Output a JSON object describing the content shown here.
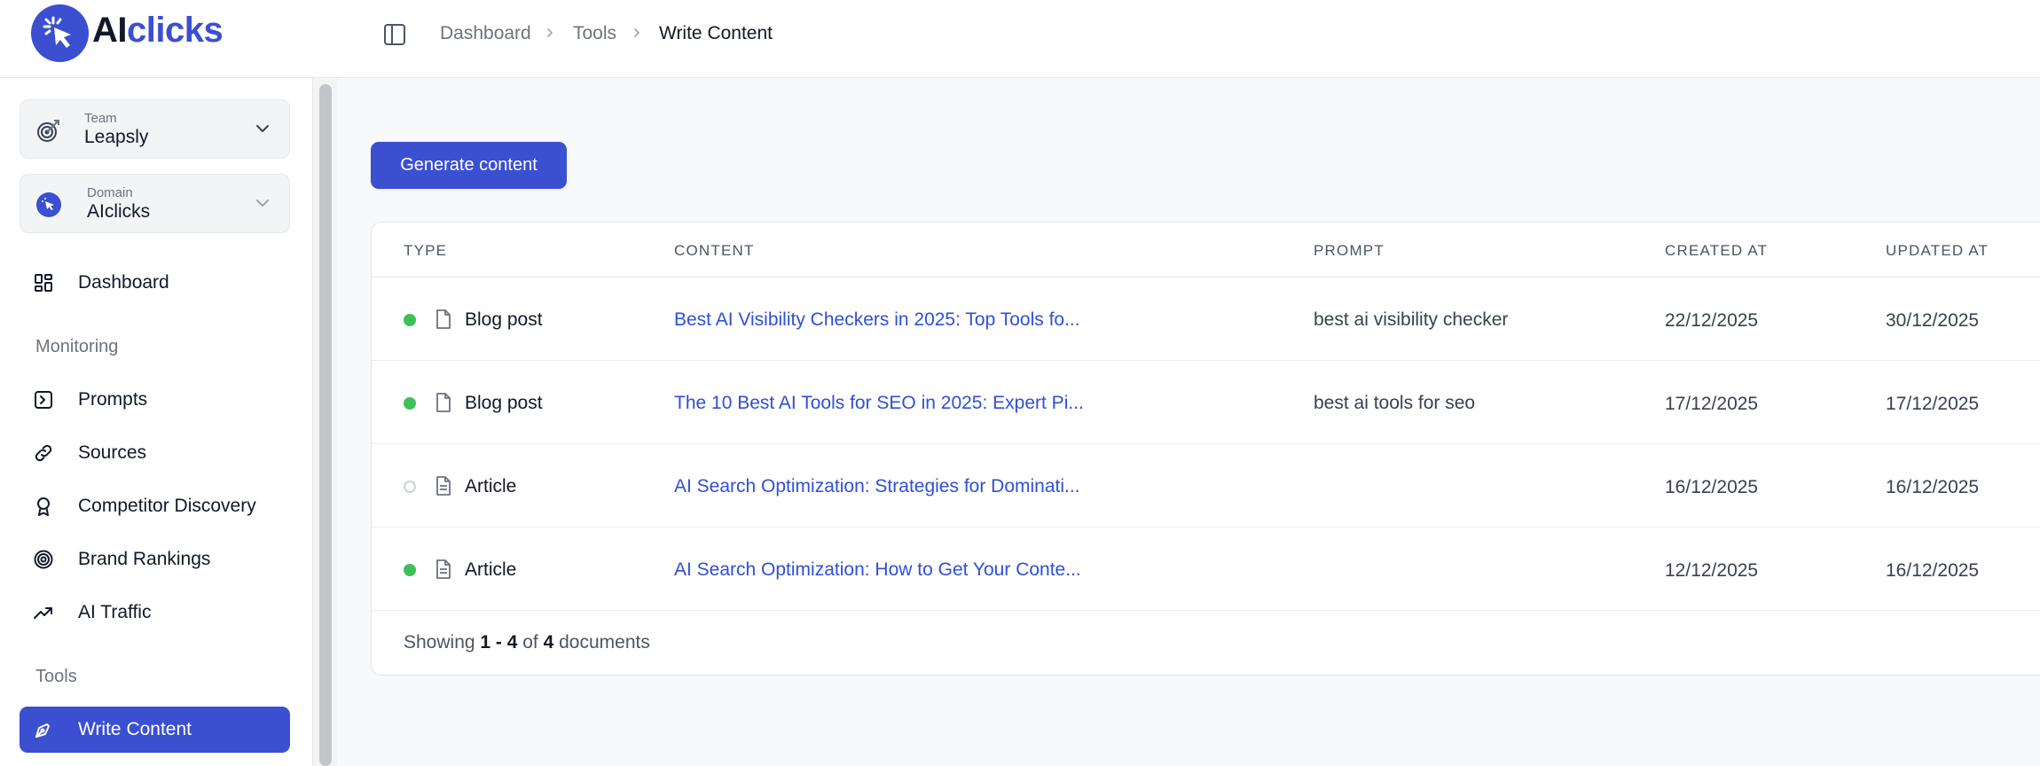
{
  "brand": {
    "name_part1": "AI",
    "name_part2": "clicks",
    "accent": "#3b4fd1"
  },
  "sidebar": {
    "team": {
      "label": "Team",
      "value": "Leapsly"
    },
    "domain": {
      "label": "Domain",
      "value": "AIclicks"
    },
    "top_items": [
      {
        "label": "Dashboard",
        "icon": "dashboard-icon"
      }
    ],
    "sections": [
      {
        "title": "Monitoring",
        "items": [
          {
            "label": "Prompts",
            "icon": "terminal-icon"
          },
          {
            "label": "Sources",
            "icon": "link-icon"
          },
          {
            "label": "Competitor Discovery",
            "icon": "award-icon"
          },
          {
            "label": "Brand Rankings",
            "icon": "target-icon"
          },
          {
            "label": "AI Traffic",
            "icon": "trending-up-icon"
          }
        ]
      },
      {
        "title": "Tools",
        "items": [
          {
            "label": "Write Content",
            "icon": "pen-tool-icon",
            "active": true
          }
        ]
      }
    ]
  },
  "header": {
    "breadcrumb": [
      "Dashboard",
      "Tools",
      "Write Content"
    ]
  },
  "main": {
    "generate_button": "Generate content",
    "table": {
      "columns": [
        "TYPE",
        "CONTENT",
        "PROMPT",
        "CREATED AT",
        "UPDATED AT"
      ],
      "rows": [
        {
          "status": "published",
          "type": "Blog post",
          "type_icon": "file-icon",
          "content": "Best AI Visibility Checkers in 2025: Top Tools fo...",
          "prompt": "best ai visibility checker",
          "created": "22/12/2025",
          "updated": "30/12/2025"
        },
        {
          "status": "published",
          "type": "Blog post",
          "type_icon": "file-icon",
          "content": "The 10 Best AI Tools for SEO in 2025: Expert Pi...",
          "prompt": "best ai tools for seo",
          "created": "17/12/2025",
          "updated": "17/12/2025"
        },
        {
          "status": "draft",
          "type": "Article",
          "type_icon": "file-text-icon",
          "content": "AI Search Optimization: Strategies for Dominati...",
          "prompt": "",
          "created": "16/12/2025",
          "updated": "16/12/2025"
        },
        {
          "status": "published",
          "type": "Article",
          "type_icon": "file-text-icon",
          "content": "AI Search Optimization: How to Get Your Conte...",
          "prompt": "",
          "created": "12/12/2025",
          "updated": "16/12/2025"
        }
      ],
      "footer": {
        "prefix": "Showing ",
        "range": "1 - 4",
        "of": " of ",
        "total": "4",
        "suffix": " documents"
      }
    }
  }
}
